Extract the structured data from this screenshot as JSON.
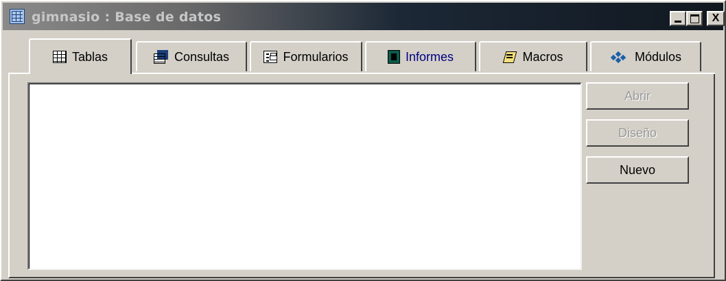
{
  "window": {
    "title": "gimnasio : Base de datos",
    "controls": {
      "minimize": "_",
      "maximize": "□",
      "close": "X"
    }
  },
  "tabs": [
    {
      "label": "Tablas",
      "icon": "table-icon",
      "active": true
    },
    {
      "label": "Consultas",
      "icon": "query-icon",
      "active": false
    },
    {
      "label": "Formularios",
      "icon": "form-icon",
      "active": false
    },
    {
      "label": "Informes",
      "icon": "report-icon",
      "active": false
    },
    {
      "label": "Macros",
      "icon": "macro-icon",
      "active": false
    },
    {
      "label": "Módulos",
      "icon": "module-icon",
      "active": false
    }
  ],
  "object_list": {
    "items": []
  },
  "buttons": {
    "abrir": {
      "label": "Abrir",
      "enabled": false
    },
    "diseno": {
      "label": "Diseño",
      "enabled": false
    },
    "nuevo": {
      "label": "Nuevo",
      "enabled": true
    }
  },
  "colors": {
    "face": "#d4d0c8",
    "title_inactive_start": "#8a8a8a",
    "title_inactive_end": "#111820",
    "informes_text": "#000080"
  }
}
